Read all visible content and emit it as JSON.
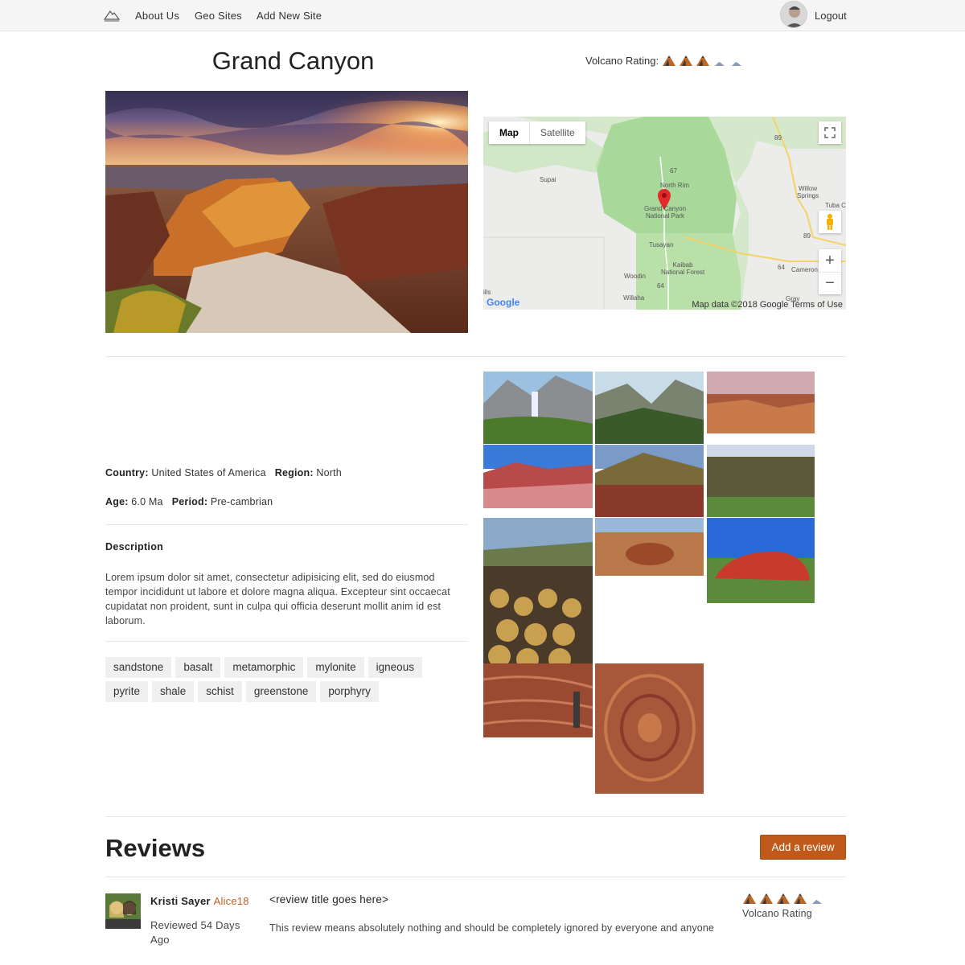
{
  "nav": {
    "logo_icon": "mountain-logo-icon",
    "links": [
      "About Us",
      "Geo Sites",
      "Add New Site"
    ],
    "logout": "Logout"
  },
  "site": {
    "title": "Grand Canyon",
    "rating_label": "Volcano Rating:",
    "rating": 3,
    "rating_max": 5
  },
  "map": {
    "type_buttons": [
      "Map",
      "Satellite"
    ],
    "labels": {
      "supai": "Supai",
      "north_rim": "North Rim",
      "park": "Grand Canyon\nNational Park",
      "willow": "Willow\nSprings",
      "tuba": "Tuba C",
      "tusayan": "Tusayan",
      "kaibab": "Kaibab\nNational Forest",
      "woodin": "Woodin",
      "williams": "Willaha",
      "cameron": "Cameron",
      "gray": "Gray",
      "ills": "ills",
      "r89a": "89",
      "r89b": "89",
      "r67": "67",
      "r64a": "64",
      "r64b": "64"
    },
    "footer": "Map data ©2018 Google   Terms of Use",
    "google": "Google"
  },
  "details": {
    "country_label": "Country:",
    "country": "United States of America",
    "region_label": "Region:",
    "region": "North",
    "age_label": "Age:",
    "age": "6.0 Ma",
    "period_label": "Period:",
    "period": "Pre-cambrian",
    "description_heading": "Description",
    "description": "Lorem ipsum dolor sit amet, consectetur adipisicing elit, sed do eiusmod tempor incididunt ut labore et dolore magna aliqua. Excepteur sint occaecat cupidatat non proident, sunt in culpa qui officia deserunt mollit anim id est laborum.",
    "tags": [
      "sandstone",
      "basalt",
      "metamorphic",
      "mylonite",
      "igneous",
      "pyrite",
      "shale",
      "schist",
      "greenstone",
      "porphyry"
    ]
  },
  "reviews": {
    "heading": "Reviews",
    "add_button": "Add a review",
    "items": [
      {
        "name": "Kristi Sayer",
        "username": "Alice18",
        "date": "Reviewed 54 Days Ago",
        "title": "<review title goes here>",
        "body": "This review means absolutely nothing and should be completely ignored by everyone and anyone",
        "rating": 4,
        "rating_label": "Volcano Rating"
      }
    ]
  },
  "colors": {
    "accent": "#c05a1a",
    "username": "#c0601e",
    "nav_bg": "#f5f5f5",
    "tag_bg": "#f0f0f0"
  }
}
